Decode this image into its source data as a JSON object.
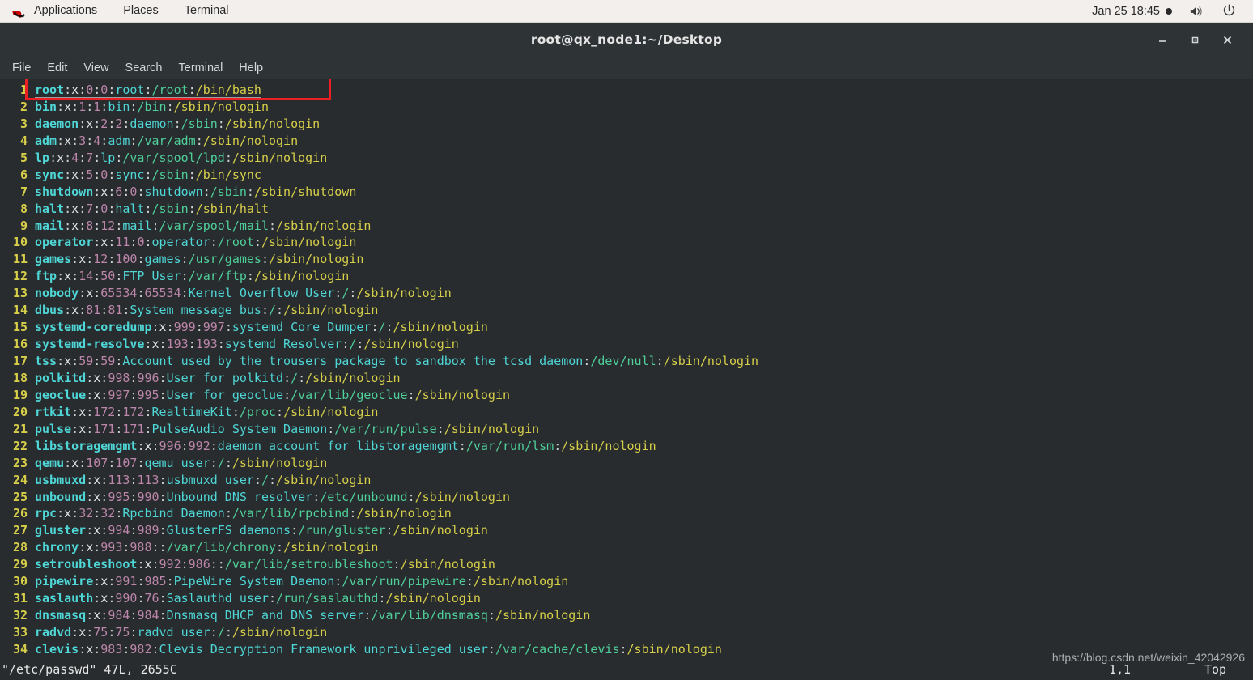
{
  "panel": {
    "items": [
      {
        "name": "applications",
        "label": "Applications"
      },
      {
        "name": "places",
        "label": "Places"
      },
      {
        "name": "terminal",
        "label": "Terminal"
      }
    ],
    "clock": "Jan 25  18:45",
    "icons": [
      "recording-dot-icon",
      "volume-icon",
      "power-icon"
    ]
  },
  "window": {
    "title": "root@qx_node1:~/Desktop",
    "buttons": [
      {
        "name": "minimize-button",
        "glyph": "–"
      },
      {
        "name": "maximize-button",
        "glyph": "■"
      },
      {
        "name": "close-button",
        "glyph": "✕"
      }
    ]
  },
  "menubar": {
    "items": [
      "File",
      "Edit",
      "View",
      "Search",
      "Terminal",
      "Help"
    ]
  },
  "editor": {
    "lines": [
      {
        "n": "1",
        "user": "root",
        "pw": "x",
        "uid": "0",
        "gid": "0",
        "gecos": "root",
        "home": "/root",
        "shell": "/bin/bash"
      },
      {
        "n": "2",
        "user": "bin",
        "pw": "x",
        "uid": "1",
        "gid": "1",
        "gecos": "bin",
        "home": "/bin",
        "shell": "/sbin/nologin"
      },
      {
        "n": "3",
        "user": "daemon",
        "pw": "x",
        "uid": "2",
        "gid": "2",
        "gecos": "daemon",
        "home": "/sbin",
        "shell": "/sbin/nologin"
      },
      {
        "n": "4",
        "user": "adm",
        "pw": "x",
        "uid": "3",
        "gid": "4",
        "gecos": "adm",
        "home": "/var/adm",
        "shell": "/sbin/nologin"
      },
      {
        "n": "5",
        "user": "lp",
        "pw": "x",
        "uid": "4",
        "gid": "7",
        "gecos": "lp",
        "home": "/var/spool/lpd",
        "shell": "/sbin/nologin"
      },
      {
        "n": "6",
        "user": "sync",
        "pw": "x",
        "uid": "5",
        "gid": "0",
        "gecos": "sync",
        "home": "/sbin",
        "shell": "/bin/sync"
      },
      {
        "n": "7",
        "user": "shutdown",
        "pw": "x",
        "uid": "6",
        "gid": "0",
        "gecos": "shutdown",
        "home": "/sbin",
        "shell": "/sbin/shutdown"
      },
      {
        "n": "8",
        "user": "halt",
        "pw": "x",
        "uid": "7",
        "gid": "0",
        "gecos": "halt",
        "home": "/sbin",
        "shell": "/sbin/halt"
      },
      {
        "n": "9",
        "user": "mail",
        "pw": "x",
        "uid": "8",
        "gid": "12",
        "gecos": "mail",
        "home": "/var/spool/mail",
        "shell": "/sbin/nologin"
      },
      {
        "n": "10",
        "user": "operator",
        "pw": "x",
        "uid": "11",
        "gid": "0",
        "gecos": "operator",
        "home": "/root",
        "shell": "/sbin/nologin"
      },
      {
        "n": "11",
        "user": "games",
        "pw": "x",
        "uid": "12",
        "gid": "100",
        "gecos": "games",
        "home": "/usr/games",
        "shell": "/sbin/nologin"
      },
      {
        "n": "12",
        "user": "ftp",
        "pw": "x",
        "uid": "14",
        "gid": "50",
        "gecos": "FTP User",
        "home": "/var/ftp",
        "shell": "/sbin/nologin"
      },
      {
        "n": "13",
        "user": "nobody",
        "pw": "x",
        "uid": "65534",
        "gid": "65534",
        "gecos": "Kernel Overflow User",
        "home": "/",
        "shell": "/sbin/nologin"
      },
      {
        "n": "14",
        "user": "dbus",
        "pw": "x",
        "uid": "81",
        "gid": "81",
        "gecos": "System message bus",
        "home": "/",
        "shell": "/sbin/nologin"
      },
      {
        "n": "15",
        "user": "systemd-coredump",
        "pw": "x",
        "uid": "999",
        "gid": "997",
        "gecos": "systemd Core Dumper",
        "home": "/",
        "shell": "/sbin/nologin"
      },
      {
        "n": "16",
        "user": "systemd-resolve",
        "pw": "x",
        "uid": "193",
        "gid": "193",
        "gecos": "systemd Resolver",
        "home": "/",
        "shell": "/sbin/nologin"
      },
      {
        "n": "17",
        "user": "tss",
        "pw": "x",
        "uid": "59",
        "gid": "59",
        "gecos": "Account used by the trousers package to sandbox the tcsd daemon",
        "home": "/dev/null",
        "shell": "/sbin/nologin"
      },
      {
        "n": "18",
        "user": "polkitd",
        "pw": "x",
        "uid": "998",
        "gid": "996",
        "gecos": "User for polkitd",
        "home": "/",
        "shell": "/sbin/nologin"
      },
      {
        "n": "19",
        "user": "geoclue",
        "pw": "x",
        "uid": "997",
        "gid": "995",
        "gecos": "User for geoclue",
        "home": "/var/lib/geoclue",
        "shell": "/sbin/nologin"
      },
      {
        "n": "20",
        "user": "rtkit",
        "pw": "x",
        "uid": "172",
        "gid": "172",
        "gecos": "RealtimeKit",
        "home": "/proc",
        "shell": "/sbin/nologin"
      },
      {
        "n": "21",
        "user": "pulse",
        "pw": "x",
        "uid": "171",
        "gid": "171",
        "gecos": "PulseAudio System Daemon",
        "home": "/var/run/pulse",
        "shell": "/sbin/nologin"
      },
      {
        "n": "22",
        "user": "libstoragemgmt",
        "pw": "x",
        "uid": "996",
        "gid": "992",
        "gecos": "daemon account for libstoragemgmt",
        "home": "/var/run/lsm",
        "shell": "/sbin/nologin"
      },
      {
        "n": "23",
        "user": "qemu",
        "pw": "x",
        "uid": "107",
        "gid": "107",
        "gecos": "qemu user",
        "home": "/",
        "shell": "/sbin/nologin"
      },
      {
        "n": "24",
        "user": "usbmuxd",
        "pw": "x",
        "uid": "113",
        "gid": "113",
        "gecos": "usbmuxd user",
        "home": "/",
        "shell": "/sbin/nologin"
      },
      {
        "n": "25",
        "user": "unbound",
        "pw": "x",
        "uid": "995",
        "gid": "990",
        "gecos": "Unbound DNS resolver",
        "home": "/etc/unbound",
        "shell": "/sbin/nologin"
      },
      {
        "n": "26",
        "user": "rpc",
        "pw": "x",
        "uid": "32",
        "gid": "32",
        "gecos": "Rpcbind Daemon",
        "home": "/var/lib/rpcbind",
        "shell": "/sbin/nologin"
      },
      {
        "n": "27",
        "user": "gluster",
        "pw": "x",
        "uid": "994",
        "gid": "989",
        "gecos": "GlusterFS daemons",
        "home": "/run/gluster",
        "shell": "/sbin/nologin"
      },
      {
        "n": "28",
        "user": "chrony",
        "pw": "x",
        "uid": "993",
        "gid": "988",
        "gecos": "",
        "home": "/var/lib/chrony",
        "shell": "/sbin/nologin"
      },
      {
        "n": "29",
        "user": "setroubleshoot",
        "pw": "x",
        "uid": "992",
        "gid": "986",
        "gecos": "",
        "home": "/var/lib/setroubleshoot",
        "shell": "/sbin/nologin"
      },
      {
        "n": "30",
        "user": "pipewire",
        "pw": "x",
        "uid": "991",
        "gid": "985",
        "gecos": "PipeWire System Daemon",
        "home": "/var/run/pipewire",
        "shell": "/sbin/nologin"
      },
      {
        "n": "31",
        "user": "saslauth",
        "pw": "x",
        "uid": "990",
        "gid": "76",
        "gecos": "Saslauthd user",
        "home": "/run/saslauthd",
        "shell": "/sbin/nologin"
      },
      {
        "n": "32",
        "user": "dnsmasq",
        "pw": "x",
        "uid": "984",
        "gid": "984",
        "gecos": "Dnsmasq DHCP and DNS server",
        "home": "/var/lib/dnsmasq",
        "shell": "/sbin/nologin"
      },
      {
        "n": "33",
        "user": "radvd",
        "pw": "x",
        "uid": "75",
        "gid": "75",
        "gecos": "radvd user",
        "home": "/",
        "shell": "/sbin/nologin"
      },
      {
        "n": "34",
        "user": "clevis",
        "pw": "x",
        "uid": "983",
        "gid": "982",
        "gecos": "Clevis Decryption Framework unprivileged user",
        "home": "/var/cache/clevis",
        "shell": "/sbin/nologin"
      }
    ]
  },
  "statusline": {
    "file": "\"/etc/passwd\" 47L, 2655C",
    "position": "1,1",
    "percent": "Top"
  },
  "watermark": "https://blog.csdn.net/weixin_42042926",
  "colors": {
    "panel_bg": "#f2efed",
    "titlebar_bg": "#2e3436",
    "terminal_bg": "#282c2e",
    "username": "#4fd6d6",
    "uid_gid": "#bd86ab",
    "gecos": "#4fd6d6",
    "home": "#4fcf9a",
    "shell": "#d7cf4a",
    "linenumber": "#d7cf4a",
    "annotation_box": "#ec2024"
  }
}
